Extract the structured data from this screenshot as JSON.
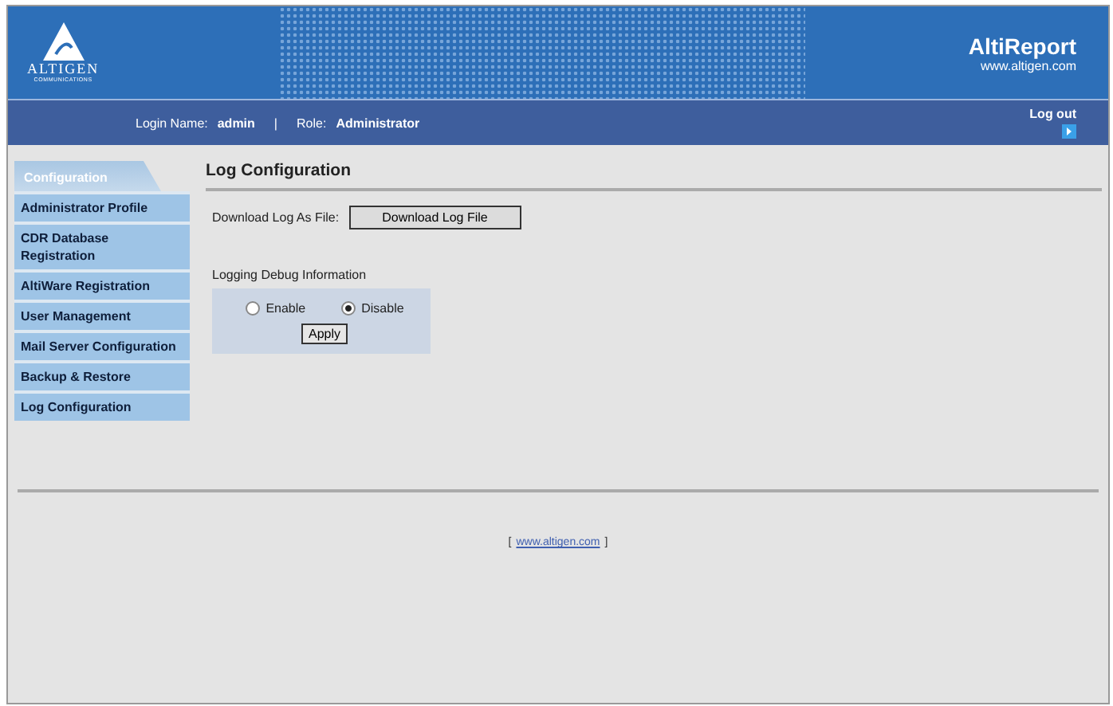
{
  "header": {
    "logo_text": "ALTIGEN",
    "logo_subtext": "COMMUNICATIONS",
    "app_title": "AltiReport",
    "app_url": "www.altigen.com"
  },
  "user_bar": {
    "login_label": "Login Name:",
    "login_value": "admin",
    "separator": "|",
    "role_label": "Role:",
    "role_value": "Administrator",
    "logout": "Log out"
  },
  "sidebar": {
    "tab": "Configuration",
    "items": [
      {
        "label": "Administrator Profile"
      },
      {
        "label": "CDR Database Registration"
      },
      {
        "label": "AltiWare Registration"
      },
      {
        "label": "User Management"
      },
      {
        "label": "Mail Server Configuration"
      },
      {
        "label": "Backup & Restore"
      },
      {
        "label": "Log Configuration"
      }
    ]
  },
  "main": {
    "title": "Log Configuration",
    "download_label": "Download Log As File:",
    "download_button": "Download Log File",
    "debug_title": "Logging Debug Information",
    "options": [
      {
        "label": "Enable",
        "selected": false
      },
      {
        "label": "Disable",
        "selected": true
      }
    ],
    "apply_button": "Apply"
  },
  "footer": {
    "bracket_open": "[",
    "link": "www.altigen.com",
    "bracket_close": "]"
  }
}
